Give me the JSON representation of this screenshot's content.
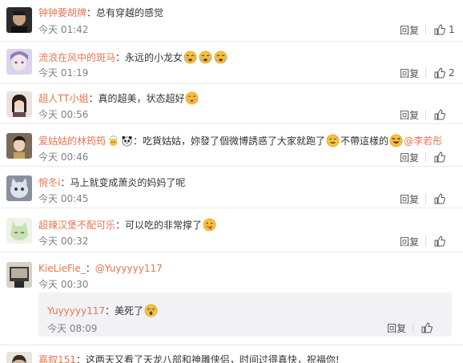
{
  "labels": {
    "reply": "回复"
  },
  "comments": [
    {
      "user": "钟钟要胡牌",
      "sep": "：",
      "text": "总有穿越的感觉",
      "time": "今天 01:42",
      "likes": "1"
    },
    {
      "user": "流浪在风中的斑马",
      "sep": "：",
      "text": "永远的小龙女",
      "time": "今天 01:19",
      "likes": "2"
    },
    {
      "user": "超人TT小姐",
      "sep": "：",
      "text": "真的超美，状态超好",
      "time": "今天 00:56",
      "likes": ""
    },
    {
      "user": "爱姑姑的林筠筠",
      "sep": "：",
      "text": "吃貨姑姑，妳發了個微博誘惑了大家就跑了",
      "text2": "不帶這樣的",
      "mention": "@李若彤",
      "time": "今天 00:46",
      "likes": ""
    },
    {
      "user": "惋冬i",
      "sep": "：",
      "text": "马上就变成萧炎的妈妈了呢",
      "time": "今天 00:45",
      "likes": ""
    },
    {
      "user": "超辣汉堡不配可乐",
      "sep": "：",
      "text": "可以吃的非常撑了",
      "time": "今天 00:32",
      "likes": ""
    },
    {
      "user": "KieLieFie_",
      "sep": "：",
      "text": "@Yuyyyyy117",
      "time": "今天 00:30",
      "likes": ""
    },
    {
      "user": "嘉叙151",
      "sep": "：",
      "text": "这两天又看了天龙八部和神雕侠侣，时间过得真快，祝福你!",
      "time": "",
      "likes": ""
    }
  ],
  "subreply": {
    "user": "Yuyyyyy117",
    "sep": "：",
    "text": "美死了",
    "time": "今天 08:09",
    "likes": ""
  },
  "colors": {
    "username": "#eb7350",
    "text": "#333333",
    "time": "#808080",
    "subreply_bg": "#f2f2f5",
    "emoji_yellow": "#f7c23c"
  }
}
